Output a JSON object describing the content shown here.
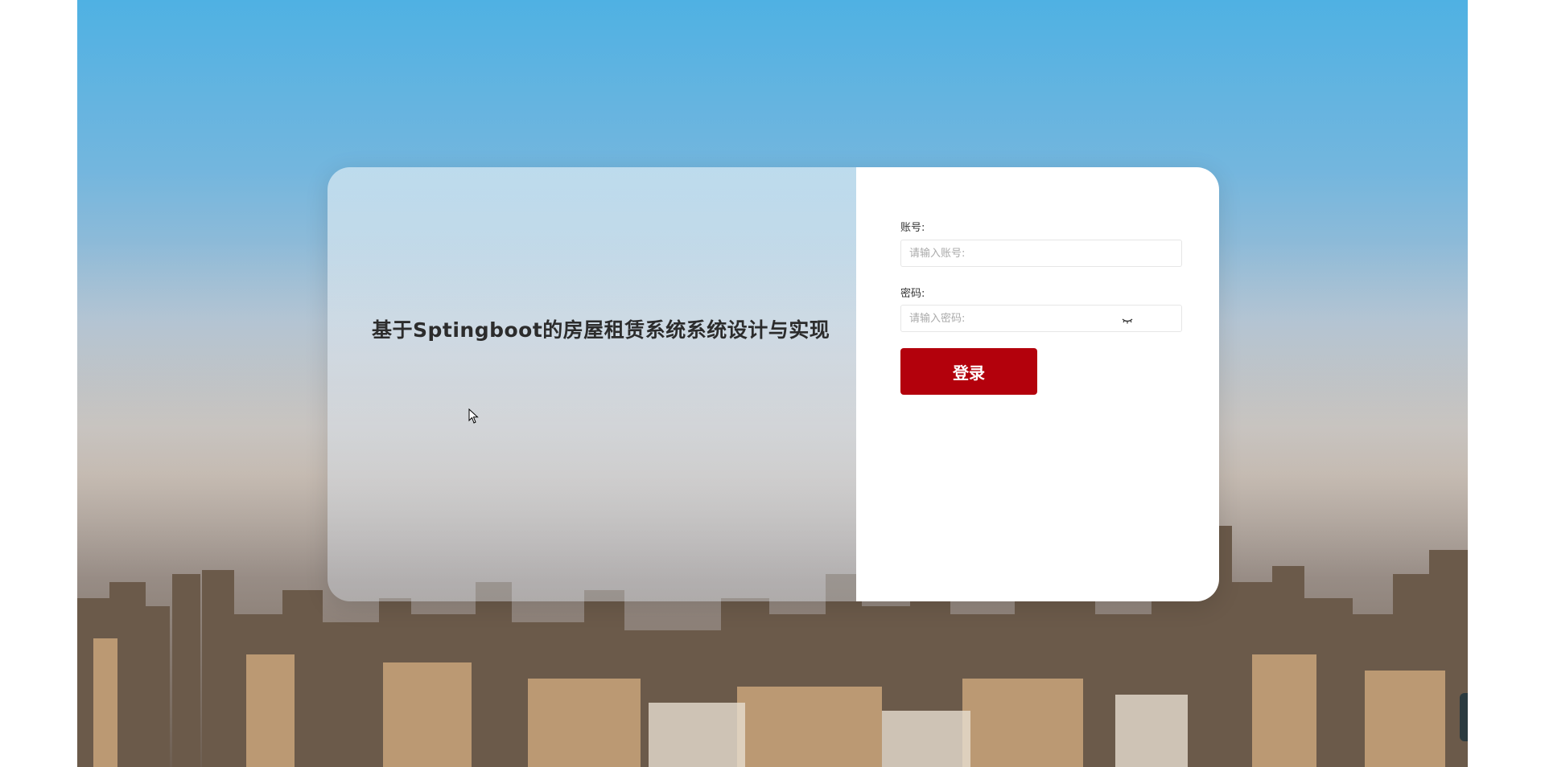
{
  "app": {
    "title": "基于Sptingboot的房屋租赁系统系统设计与实现"
  },
  "login": {
    "account_label": "账号:",
    "account_placeholder": "请输入账号:",
    "password_label": "密码:",
    "password_placeholder": "请输入密码:",
    "submit_label": "登录",
    "password_toggle_icon": "eye-closed-icon"
  },
  "colors": {
    "accent": "#b3010c",
    "card_right_bg": "#ffffff"
  }
}
